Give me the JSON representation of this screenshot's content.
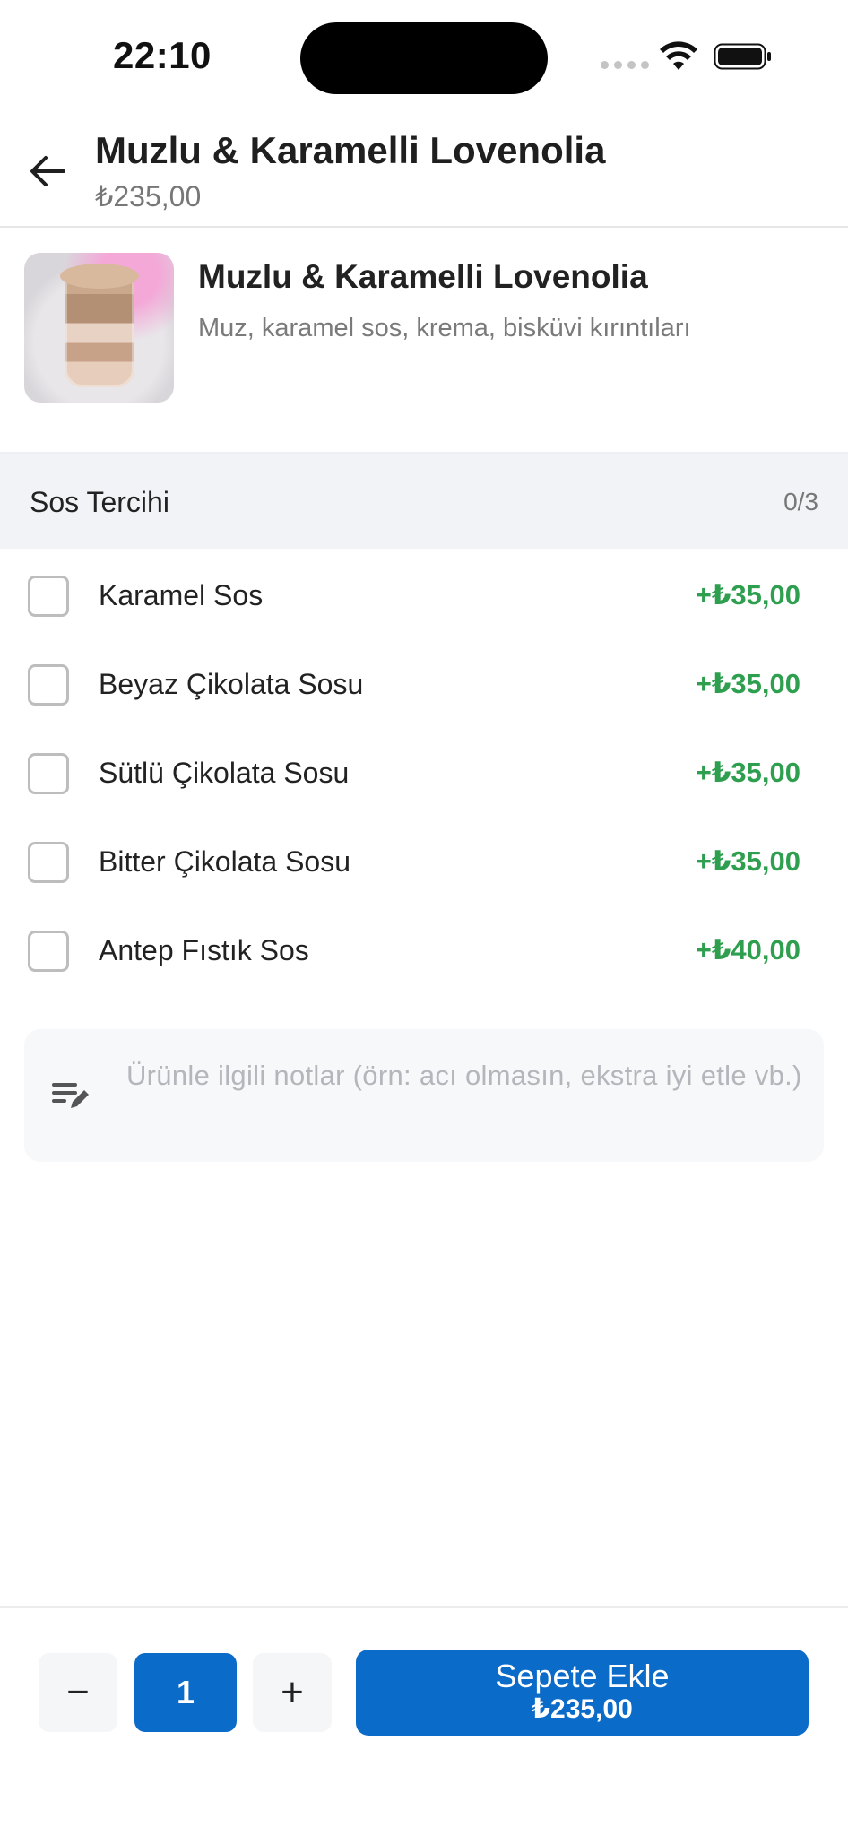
{
  "status_bar": {
    "time": "22:10"
  },
  "header": {
    "title": "Muzlu & Karamelli Lovenolia",
    "price": "₺235,00"
  },
  "product": {
    "name": "Muzlu & Karamelli Lovenolia",
    "description": "Muz, karamel sos, krema, bisküvi kırıntıları"
  },
  "section": {
    "title": "Sos Tercihi",
    "count": "0/3"
  },
  "options": [
    {
      "label": "Karamel Sos",
      "price": "+₺35,00",
      "checked": false
    },
    {
      "label": "Beyaz Çikolata Sosu",
      "price": "+₺35,00",
      "checked": false
    },
    {
      "label": "Sütlü Çikolata Sosu",
      "price": "+₺35,00",
      "checked": false
    },
    {
      "label": "Bitter Çikolata Sosu",
      "price": "+₺35,00",
      "checked": false
    },
    {
      "label": "Antep Fıstık Sos",
      "price": "+₺40,00",
      "checked": false
    }
  ],
  "note": {
    "placeholder": "Ürünle ilgili notlar (örn: acı olmasın, ekstra iyi etle vb.)"
  },
  "cart": {
    "decrement": "−",
    "quantity": "1",
    "increment": "+",
    "add_label": "Sepete Ekle",
    "add_price": "₺235,00"
  },
  "colors": {
    "primary": "#0b6bc8",
    "price_green": "#2e9e4f",
    "section_bg": "#f1f3f7"
  },
  "icons": {
    "back": "arrow-left-icon",
    "note": "edit-note-icon"
  }
}
